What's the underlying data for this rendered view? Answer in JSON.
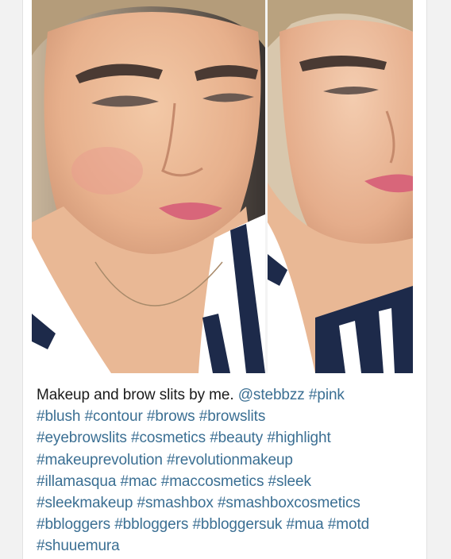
{
  "post": {
    "caption_text": "Makeup and brow slits by me.",
    "mention": "@stebbzz",
    "hashtags": [
      "#pink",
      "#blush",
      "#contour",
      "#brows",
      "#browslits",
      "#eyebrowslits",
      "#cosmetics",
      "#beauty",
      "#highlight",
      "#makeuprevolution",
      "#revolutionmakeup",
      "#illamasqua",
      "#mac",
      "#maccosmetics",
      "#sleek",
      "#sleekmakeup",
      "#smashbox",
      "#smashboxcosmetics",
      "#bbloggers",
      "#bbloggers",
      "#bbloggersuk",
      "#mua",
      "#motd",
      "#shuuemura"
    ]
  },
  "colors": {
    "link": "#3b6f93",
    "text": "#1a1a1a",
    "card_bg": "#ffffff",
    "page_bg": "#f2f2f2"
  }
}
